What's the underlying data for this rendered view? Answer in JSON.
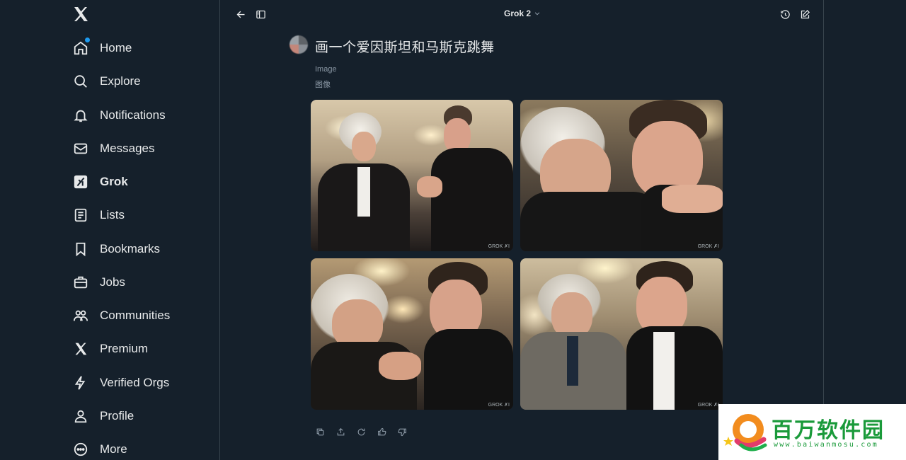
{
  "sidebar": {
    "logo": "x-logo-icon",
    "items": [
      {
        "label": "Home",
        "icon": "home-icon"
      },
      {
        "label": "Explore",
        "icon": "search-icon"
      },
      {
        "label": "Notifications",
        "icon": "bell-icon"
      },
      {
        "label": "Messages",
        "icon": "envelope-icon"
      },
      {
        "label": "Grok",
        "icon": "grok-icon"
      },
      {
        "label": "Lists",
        "icon": "list-icon"
      },
      {
        "label": "Bookmarks",
        "icon": "bookmark-icon"
      },
      {
        "label": "Jobs",
        "icon": "briefcase-icon"
      },
      {
        "label": "Communities",
        "icon": "people-icon"
      },
      {
        "label": "Premium",
        "icon": "x-icon"
      },
      {
        "label": "Verified Orgs",
        "icon": "lightning-icon"
      },
      {
        "label": "Profile",
        "icon": "person-icon"
      },
      {
        "label": "More",
        "icon": "more-circle-icon"
      }
    ]
  },
  "topbar": {
    "model": "Grok 2"
  },
  "conversation": {
    "prompt": "画一个爱因斯坦和马斯克跳舞",
    "response_label_en": "Image",
    "response_label_zh": "图像",
    "image_watermark": "GROK ✗I"
  },
  "brand": {
    "title": "百万软件园",
    "url": "www.baiwanmosu.com"
  },
  "colors": {
    "background": "#15202b",
    "border": "#38444d",
    "accent": "#1d9bf0",
    "text": "#e7e9ea",
    "muted": "#8b98a5",
    "brand_green": "#1a9a3a"
  }
}
